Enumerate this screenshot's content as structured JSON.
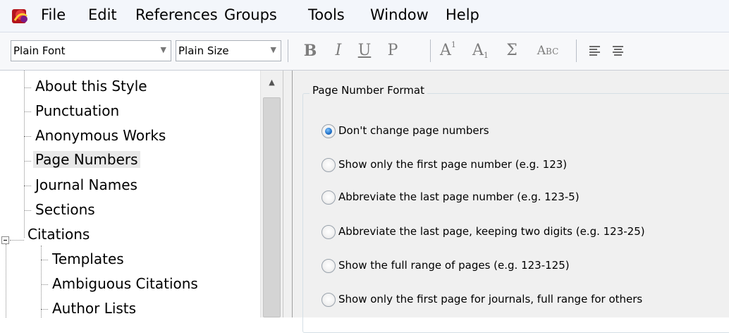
{
  "menubar": {
    "items": [
      "File",
      "Edit",
      "References",
      "Groups",
      "Tools",
      "Window",
      "Help"
    ]
  },
  "toolbar": {
    "font_value": "Plain Font",
    "size_value": "Plain Size",
    "bold": "B",
    "italic": "I",
    "underline": "U",
    "plain": "P",
    "superscript": "A",
    "superscript_mark": "1",
    "subscript": "A",
    "subscript_mark": "1",
    "symbol": "Σ",
    "smallcaps": "Abc"
  },
  "tree": {
    "items": [
      {
        "label": "About this Style"
      },
      {
        "label": "Punctuation"
      },
      {
        "label": "Anonymous Works"
      },
      {
        "label": "Page Numbers",
        "selected": true
      },
      {
        "label": "Journal Names"
      },
      {
        "label": "Sections"
      },
      {
        "label": "Citations",
        "expanded": true
      },
      {
        "label": "Templates"
      },
      {
        "label": "Ambiguous Citations"
      },
      {
        "label": "Author Lists"
      }
    ]
  },
  "page_number_format": {
    "title": "Page Number Format",
    "options": [
      {
        "label": "Don't change page numbers",
        "checked": true
      },
      {
        "label": "Show only the first page number (e.g. 123)",
        "checked": false
      },
      {
        "label": "Abbreviate the last page number (e.g. 123-5)",
        "checked": false
      },
      {
        "label": "Abbreviate the last page, keeping two digits (e.g. 123-25)",
        "checked": false
      },
      {
        "label": "Show the full range of pages (e.g. 123-125)",
        "checked": false
      },
      {
        "label": "Show only the first page for journals, full range for others",
        "checked": false
      }
    ]
  },
  "colors": {
    "menubar_bg": "#f3f6fb",
    "pane_bg": "#f0f0f0",
    "selected_bg": "#e8e8e8",
    "radio_checked": "#1f6fc6"
  }
}
